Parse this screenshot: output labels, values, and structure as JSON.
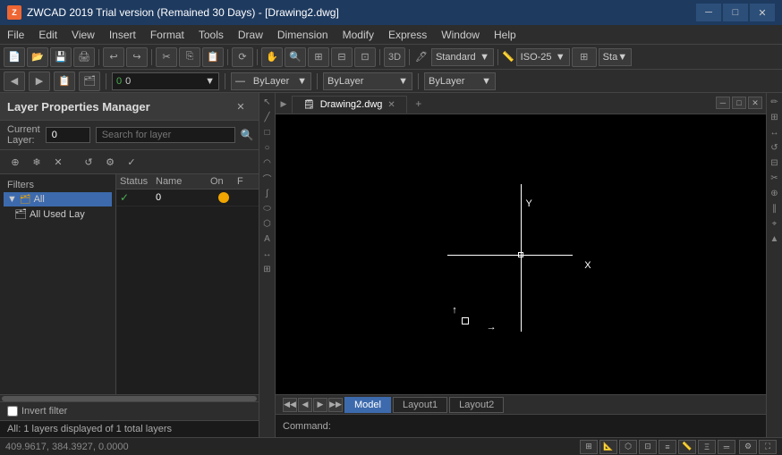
{
  "titlebar": {
    "title": "ZWCAD 2019 Trial version (Remained 30 Days) - [Drawing2.dwg]",
    "logo": "Z",
    "min_btn": "─",
    "max_btn": "□",
    "close_btn": "✕"
  },
  "menubar": {
    "items": [
      "File",
      "Edit",
      "View",
      "Insert",
      "Format",
      "Tools",
      "Draw",
      "Dimension",
      "Modify",
      "Express",
      "Window",
      "Help"
    ]
  },
  "toolbar1": {
    "dropdowns": [
      "Standard",
      "ISO-25",
      "Sta"
    ]
  },
  "layer_toolbar": {
    "layer_value": "0",
    "bylayer_color": "ByLayer",
    "bylayer_line": "ByLayer",
    "bylayer_lw": "ByLayer"
  },
  "panel": {
    "title": "Layer Properties Manager",
    "close_btn": "✕",
    "current_layer_label": "Current Layer:",
    "current_layer_value": "0",
    "search_placeholder": "Search for layer",
    "filters_label": "Filters",
    "tree_items": [
      {
        "label": "All",
        "indent": 0,
        "selected": true
      },
      {
        "label": "All Used Lay",
        "indent": 1,
        "selected": false
      }
    ],
    "layer_cols": [
      "Status",
      "Name",
      "On",
      "F"
    ],
    "layers": [
      {
        "status": "✓",
        "name": "0",
        "on": true,
        "freeze": ""
      }
    ],
    "invert_label": "Invert filter",
    "status_text": "All: 1 layers displayed of 1 total layers",
    "toolbar_btns": [
      "⊕",
      "✕",
      "🔧",
      "↑",
      "↓",
      "✓"
    ]
  },
  "canvas": {
    "title": "Drawing2.dwg",
    "close_btn": "✕",
    "model_tabs": [
      "Model",
      "Layout1",
      "Layout2"
    ],
    "active_tab": "Model",
    "nav_btns": [
      "◀◀",
      "◀",
      "▶",
      "▶▶"
    ]
  },
  "command": {
    "label": "Command:",
    "value": ""
  },
  "statusbar": {
    "coords": "409.9617, 384.3927, 0.0000",
    "btns": [
      "⊞",
      "📐",
      "🔲",
      "📏",
      "≡",
      "📊",
      "🔧",
      "↔"
    ]
  }
}
